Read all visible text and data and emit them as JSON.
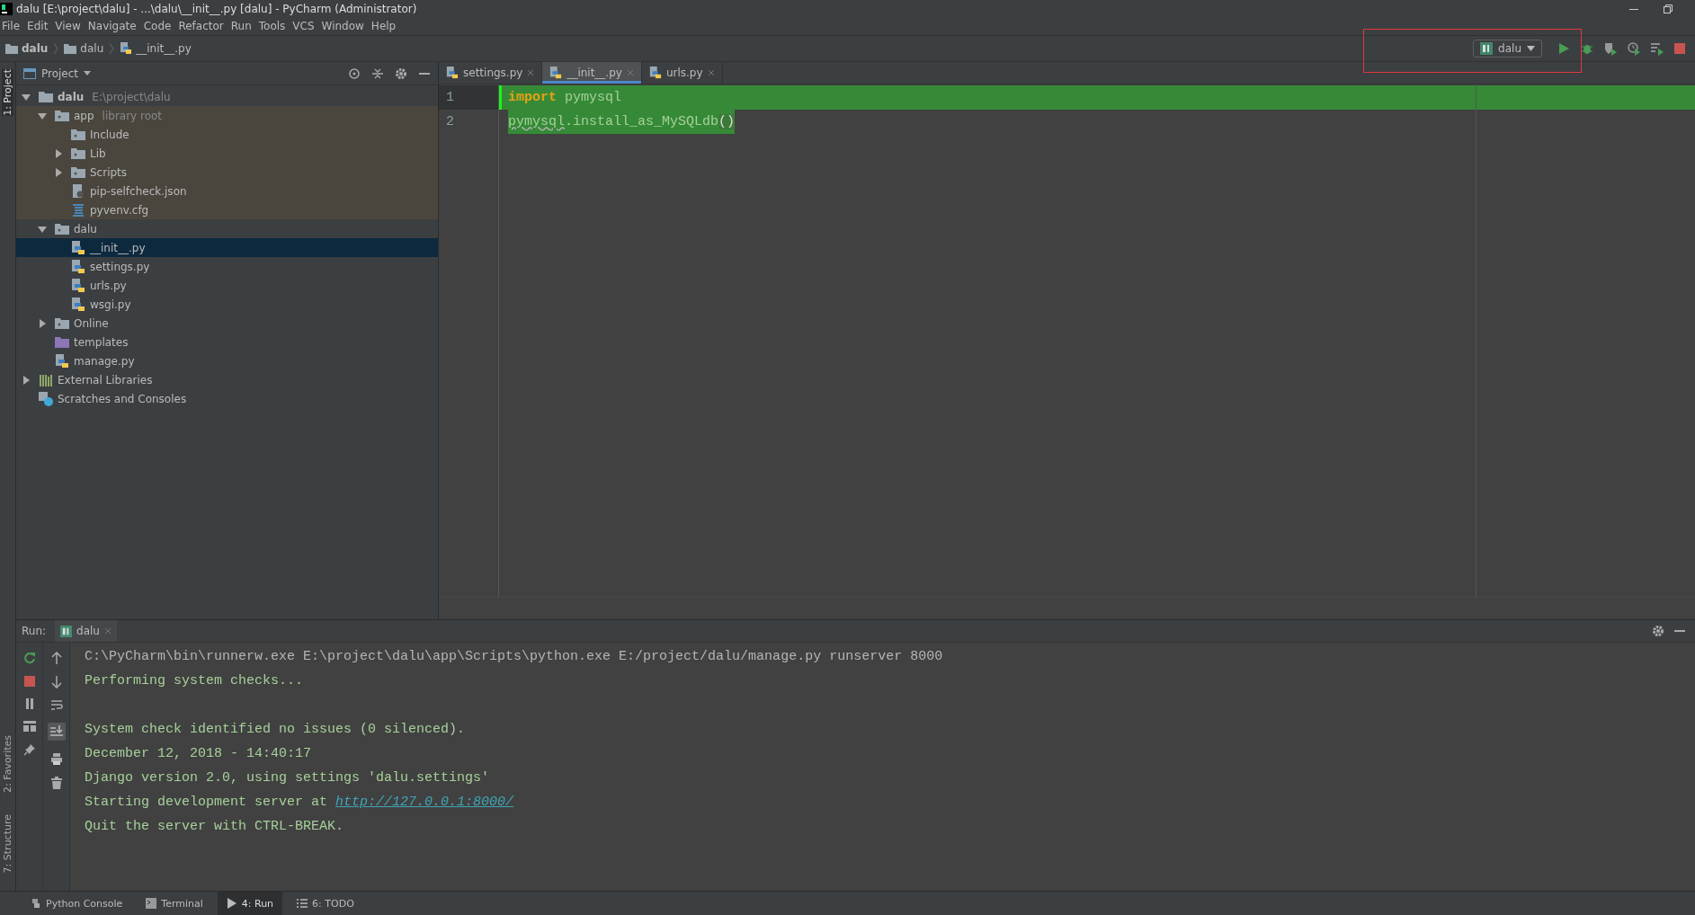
{
  "window": {
    "title": "dalu [E:\\project\\dalu] - ...\\dalu\\__init__.py [dalu] - PyCharm (Administrator)"
  },
  "menu": [
    "File",
    "Edit",
    "View",
    "Navigate",
    "Code",
    "Refactor",
    "Run",
    "Tools",
    "VCS",
    "Window",
    "Help"
  ],
  "breadcrumb": [
    {
      "label": "dalu",
      "kind": "project"
    },
    {
      "label": "dalu",
      "kind": "folder"
    },
    {
      "label": "__init__.py",
      "kind": "python"
    }
  ],
  "run_config": {
    "label": "dalu"
  },
  "side_strip": {
    "top": [
      {
        "label": "1: Project",
        "selected": true
      }
    ],
    "bottom": [
      {
        "label": "2: Favorites",
        "selected": false
      },
      {
        "label": "7: Structure",
        "selected": false
      }
    ]
  },
  "project": {
    "title": "Project",
    "tree": [
      {
        "label": "dalu",
        "note": "E:\\project\\dalu",
        "kind": "folder",
        "expanded": true,
        "selected": false,
        "library": false,
        "children": [
          {
            "label": "app",
            "note": "library root",
            "kind": "source-folder",
            "expanded": true,
            "selected": false,
            "library": true,
            "children": [
              {
                "label": "Include",
                "kind": "source-folder",
                "selected": false,
                "library": true
              },
              {
                "label": "Lib",
                "kind": "source-folder",
                "expanded": false,
                "selected": false,
                "library": true
              },
              {
                "label": "Scripts",
                "kind": "source-folder",
                "expanded": false,
                "selected": false,
                "library": true
              },
              {
                "label": "pip-selfcheck.json",
                "kind": "json",
                "selected": false,
                "library": true
              },
              {
                "label": "pyvenv.cfg",
                "kind": "cfg",
                "selected": false,
                "library": true
              }
            ]
          },
          {
            "label": "dalu",
            "kind": "source-folder",
            "expanded": true,
            "selected": false,
            "library": false,
            "children": [
              {
                "label": "__init__.py",
                "kind": "python",
                "selected": true,
                "library": false
              },
              {
                "label": "settings.py",
                "kind": "python",
                "selected": false,
                "library": false
              },
              {
                "label": "urls.py",
                "kind": "python",
                "selected": false,
                "library": false
              },
              {
                "label": "wsgi.py",
                "kind": "python",
                "selected": false,
                "library": false
              }
            ]
          },
          {
            "label": "Online",
            "kind": "source-folder",
            "expanded": false,
            "selected": false,
            "library": false
          },
          {
            "label": "templates",
            "kind": "template-folder",
            "selected": false,
            "library": false
          },
          {
            "label": "manage.py",
            "kind": "python",
            "selected": false,
            "library": false
          }
        ]
      },
      {
        "label": "External Libraries",
        "kind": "libraries",
        "expanded": false,
        "selected": false,
        "library": false
      },
      {
        "label": "Scratches and Consoles",
        "kind": "scratches",
        "selected": false,
        "library": false
      }
    ]
  },
  "editor": {
    "tabs": [
      {
        "label": "settings.py",
        "selected": false
      },
      {
        "label": "__init__.py",
        "selected": true
      },
      {
        "label": "urls.py",
        "selected": false
      }
    ],
    "lines": [
      {
        "number": "1",
        "whole_line_highlighted": true,
        "tokens": [
          {
            "text": "import",
            "kind": "keyword"
          },
          {
            "text": " pymysql",
            "kind": "plain"
          }
        ]
      },
      {
        "number": "2",
        "whole_line_highlighted": false,
        "tokens": [
          {
            "text": "pymysql",
            "kind": "warning"
          },
          {
            "text": ".install_as_MySQLdb",
            "kind": "plain"
          },
          {
            "text": "()",
            "kind": "brace"
          }
        ]
      }
    ]
  },
  "run": {
    "label": "Run:",
    "tab": "dalu",
    "console": [
      {
        "kind": "command",
        "text": "C:\\PyCharm\\bin\\runnerw.exe E:\\project\\dalu\\app\\Scripts\\python.exe E:/project/dalu/manage.py runserver 8000"
      },
      {
        "kind": "output",
        "text": "Performing system checks..."
      },
      {
        "kind": "blank"
      },
      {
        "kind": "output",
        "text": "System check identified no issues (0 silenced)."
      },
      {
        "kind": "output",
        "text": "December 12, 2018 - 14:40:17"
      },
      {
        "kind": "output",
        "text": "Django version 2.0, using settings 'dalu.settings'"
      },
      {
        "kind": "output",
        "text": "Starting development server at ",
        "link": "http://127.0.0.1:8000/"
      },
      {
        "kind": "output",
        "text": "Quit the server with CTRL-BREAK."
      }
    ]
  },
  "bottom_tabs": [
    {
      "label": "Python Console",
      "kind": "python",
      "selected": false
    },
    {
      "label": "Terminal",
      "kind": "terminal",
      "selected": false
    },
    {
      "label": "4: Run",
      "kind": "run",
      "selected": true
    },
    {
      "label": "6: TODO",
      "kind": "todo",
      "selected": false
    }
  ]
}
